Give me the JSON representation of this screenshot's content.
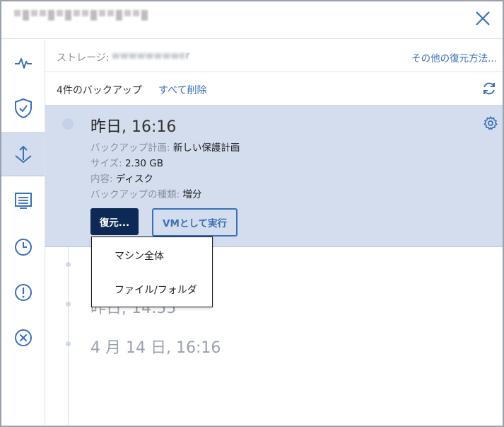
{
  "window": {
    "close_icon": "close-x-icon"
  },
  "sidebar": {
    "items": [
      {
        "name": "activity",
        "icon": "pulse-icon"
      },
      {
        "name": "protection",
        "icon": "shield-check-icon"
      },
      {
        "name": "recovery",
        "icon": "recovery-icon",
        "active": true
      },
      {
        "name": "details",
        "icon": "document-list-icon"
      },
      {
        "name": "history",
        "icon": "clock-icon"
      },
      {
        "name": "alerts",
        "icon": "exclamation-icon"
      },
      {
        "name": "delete",
        "icon": "close-circle-icon"
      }
    ]
  },
  "storage": {
    "label": "ストレージ:",
    "value_obscured": "r",
    "other_recovery_link": "その他の復元方法..."
  },
  "backups": {
    "count_label": "4件のバックアップ",
    "delete_all": "すべて削除"
  },
  "selected_backup": {
    "date_prefix": "昨日",
    "date_time": ", 16:16",
    "details": [
      {
        "key": "バックアップ計画:",
        "value": "新しい保護計画"
      },
      {
        "key": "サイズ:",
        "value": "2.30 GB"
      },
      {
        "key": "内容:",
        "value": "ディスク"
      },
      {
        "key": "バックアップの種類:",
        "value": "増分"
      }
    ],
    "restore_button": "復元...",
    "run_vm_button": "VMとして実行"
  },
  "restore_menu": {
    "items": [
      "マシン全体",
      "ファイル/フォルダ"
    ]
  },
  "timeline": [
    {
      "date": "昨日, 14:55"
    },
    {
      "date": "4 月 14 日, 16:16"
    }
  ],
  "colors": {
    "accent": "#3b6fb6",
    "selected_bg": "#d3ddee",
    "primary_button": "#0c2a55"
  }
}
